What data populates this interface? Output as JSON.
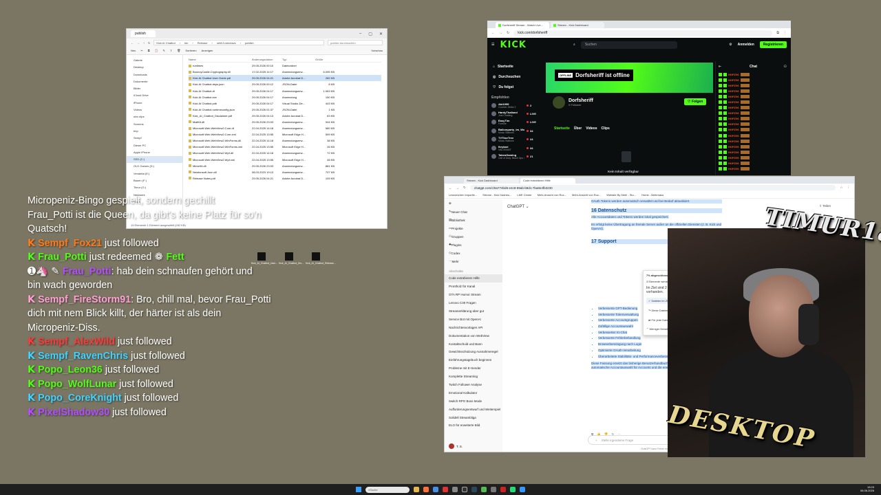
{
  "explorer": {
    "title": "publish",
    "path": [
      "Kick AI Chatbot",
      "bin",
      "Release",
      "net8.0-windows",
      "publish"
    ],
    "search_placeholder": "publish durchsuchen",
    "commands": [
      "Neu",
      "Sortieren",
      "Anzeigen",
      "Vorschau"
    ],
    "nav": [
      "Galerie",
      "Desktop",
      "Downloads",
      "Dokumente",
      "Bilder",
      "iCloud Drive",
      "iPhone",
      "Videos",
      "obs clips",
      "Screens",
      "tmp",
      "Sempf",
      "Dieser PC",
      "Apple iPhone",
      "SSD (C:)",
      "OLD Games (D:)",
      "Vendetta (E:)",
      "Bauen (F:)",
      "Timur (G:)",
      "Netzwerk",
      "Linux"
    ],
    "nav_selected": 14,
    "headers": [
      "Name",
      "Änderungsdatum",
      "Typ",
      "Größe"
    ],
    "files": [
      {
        "name": "runtimes",
        "date": "29.05.2026 00:10",
        "type": "Dateiordner",
        "size": ""
      },
      {
        "name": "BouncyCastle.Cryptography.dll",
        "date": "17.02.2025 14:17",
        "type": "Anwendungserw...",
        "size": "6.095 KB"
      },
      {
        "name": "Kick AI Chatbot User Guide.pdf",
        "date": "29.05.2026 04:21",
        "type": "Adobe Acrobat D...",
        "size": "282 KB"
      },
      {
        "name": "Kick AI Chatbot.deps.json",
        "date": "29.05.2026 00:12",
        "type": "JSON-Datei",
        "size": "8 KB"
      },
      {
        "name": "Kick AI Chatbot.dll",
        "date": "29.05.2026 04:17",
        "type": "Anwendungserw...",
        "size": "1.063 KB"
      },
      {
        "name": "Kick AI Chatbot.exe",
        "date": "29.05.2026 04:17",
        "type": "Anwendung",
        "size": "150 KB"
      },
      {
        "name": "Kick AI Chatbot.pdb",
        "date": "29.05.2026 04:17",
        "type": "Visual Studio-De...",
        "size": "443 KB"
      },
      {
        "name": "Kick AI Chatbot.runtimeconfig.json",
        "date": "29.05.2026 01:37",
        "type": "JSON-Datei",
        "size": "1 KB"
      },
      {
        "name": "Kick_AI_Chatbot_Disclaimer.pdf",
        "date": "29.05.2026 04:13",
        "type": "Adobe Acrobat D...",
        "size": "63 KB"
      },
      {
        "name": "MailKit.dll",
        "date": "29.05.2026 23:03",
        "type": "Anwendungserw...",
        "size": "944 KB"
      },
      {
        "name": "Microsoft.Web.WebView2.Core.dll",
        "date": "22.04.2025 14:18",
        "type": "Anwendungserw...",
        "size": "580 KB"
      },
      {
        "name": "Microsoft.Web.WebView2.Core.xml",
        "date": "22.04.2025 13:55",
        "type": "Microsoft Edge H...",
        "size": "599 KB"
      },
      {
        "name": "Microsoft.Web.WebView2.WinForms.dll",
        "date": "22.04.2025 14:18",
        "type": "Anwendungserw...",
        "size": "38 KB"
      },
      {
        "name": "Microsoft.Web.WebView2.WinForms.xml",
        "date": "22.04.2025 13:55",
        "type": "Microsoft Edge H...",
        "size": "26 KB"
      },
      {
        "name": "Microsoft.Web.WebView2.Wpf.dll",
        "date": "22.04.2025 14:18",
        "type": "Anwendungserw...",
        "size": "72 KB"
      },
      {
        "name": "Microsoft.Web.WebView2.Wpf.xml",
        "date": "22.04.2025 13:55",
        "type": "Microsoft Edge H...",
        "size": "48 KB"
      },
      {
        "name": "MimeKit.dll",
        "date": "29.05.2026 23:03",
        "type": "Anwendungserw...",
        "size": "881 KB"
      },
      {
        "name": "Newtonsoft.Json.dll",
        "date": "08.03.2023 19:13",
        "type": "Anwendungserw...",
        "size": "707 KB"
      },
      {
        "name": "Release Notes.pdf",
        "date": "29.05.2026 04:21",
        "type": "Adobe Acrobat D...",
        "size": "109 KB"
      }
    ],
    "selected_file": 2,
    "status": "19 Elemente   1 Element ausgewählt (282 KB)"
  },
  "kick": {
    "tabs": [
      "Dorfsheriff Stream - Watch Live...",
      "Stream - Kick Dashboard"
    ],
    "url": "kick.com/dorfsheriff",
    "search_placeholder": "Suchen",
    "login": "Anmelden",
    "register": "Registrieren",
    "nav": [
      "Startseite",
      "Durchsuchen",
      "Du folgst"
    ],
    "recommended_label": "Empfohlen",
    "channels": [
      {
        "name": "Abi1995",
        "game": "Counter-Strike 2",
        "viewers": "2"
      },
      {
        "name": "HardyThailand",
        "game": "Just Chatting",
        "viewers": "LIVE"
      },
      {
        "name": "EasyTim",
        "game": "Fortnite",
        "viewers": "LIVE"
      },
      {
        "name": "Balkonparty_im_Wo...",
        "game": "Music Stations",
        "viewers": "34"
      },
      {
        "name": "TVThorTree",
        "game": "Music Stations",
        "viewers": "24"
      },
      {
        "name": "Ihrykari",
        "game": "VALORANT",
        "viewers": "34"
      },
      {
        "name": "TakeoGaming",
        "game": "Call of Duty: Black Ops 7",
        "viewers": "21"
      }
    ],
    "offline_tag": "OFFLINE",
    "offline_text": "Dorfsheriff ist offline",
    "channel_name": "Dorfsheriff",
    "followers": "0 Follower",
    "follow_btn": "Folgen",
    "subtabs": [
      "Startseite",
      "Über",
      "Videos",
      "Clips"
    ],
    "no_content": "Kein Inhalt verfügbar",
    "chat_title": "Chat",
    "chat_name": "HOPZ96"
  },
  "gpt": {
    "tabs": [
      "Stream - Kick Dashboard",
      "Code extrahieren Hilfe"
    ],
    "url": "chatgpt.com/c/6a774bd6-e4c8-89ab-b8d1-7ba8e4fb3230",
    "bookmarks": [
      "Lesezeichen importie...",
      "Stream - Kick Dashbo...",
      "LME Center",
      "Mehl-Ansicht von Ruc...",
      "Mehl-Ansicht von Ruc...",
      "Website By Mehl - Stu...",
      "Home - Beitrmaus"
    ],
    "sidebar_items": [
      "Neuer Chat",
      "Bibliothek",
      "Projekte",
      "Gruppen",
      "Plugins",
      "Codex",
      "Mehr"
    ],
    "history_label": "Abschnitte",
    "history": [
      "Code extrahieren Hilfe",
      "Prontholz für Kanal",
      "GTA RP Humor Stream",
      "Lenovo C30 Fragen",
      "Streamerklärung aber gut",
      "Service Bot mit OpenAI",
      "Nachrichtenvorlagen API",
      "Dokumentation von WebView",
      "Kontaktschuld und Bann",
      "Gewichtsschützung Ausnahmeregel",
      "Einführungstagebuch beginnen",
      "Probleme mit E-Sender",
      "Komplette Streamlog",
      "Twitch Follower Analyse",
      "Emotional Kalkulator",
      "Switch RPG Boss Mode",
      "Aufforderungsentwurf und Weiterspiel",
      "Solidell Streambliga",
      "ELO für erweiterte Bild"
    ],
    "active_history": 0,
    "model": "ChatGPT",
    "share": "Teilen",
    "top_text": "OAuth Tokens werden automatisch verwaltet und bei Bedarf aktualisiert.",
    "h16": "16 Datenschutz",
    "p16a": "Alle Accountdaten und Tokens werden lokal gespeichert.",
    "p16b": "Es erfolgt keine Übertragung an fremde Server außer an die offiziellen Diensten (z. B. Kick und OpenAI).",
    "h17": "17 Support",
    "list": [
      "Verbesserte GPT-Bedienung",
      "Verbesserte Tokenverwaltung",
      "Verbesserte Accountgruppen",
      "Zufällige Accountauswahl",
      "Verbesserter KI-Chat",
      "Verbesserte Fehlerbehandlung",
      "Browserbereinigung nach Login",
      "Optimierte OAuth-Verarbeitung",
      "Überarbeitete Stabilitäts- und Performanceverbesserungen"
    ],
    "summary": "Diese Fassung ersetzt das bisherige Benutzerhandbuch und enthält die neuen Funktionen wie automatische Accountauswahl für Accounts und die erweiterten Automatisierungen.",
    "dialog_title": "7% abgeschlossen",
    "dialog_line": "3 Elemente werden von Desktop nach publish kopiert",
    "dialog_q": "Im Ziel sind 2 Dateien mit dem gleichen Namen vorhanden.",
    "dialog_opts": [
      "Dateien im Ziel ersetzen",
      "Diese Dateien überspringen",
      "Für jede Datei selbst entscheiden"
    ],
    "dialog_more": "Weniger Details",
    "prompt": "Stelle irgendeine Frage",
    "disclaimer": "ChatGPT kann Fehler machen.",
    "user": "T. S."
  },
  "overlay": {
    "lines": [
      {
        "kind": "text",
        "text": "Micropeniz-Bingo gespielt, sondern gechillt"
      },
      {
        "kind": "text",
        "text": "Frau_Potti ist die Queen, da gibt's keine Platz für so'n"
      },
      {
        "kind": "text",
        "text": "Quatsch!"
      },
      {
        "kind": "event",
        "user": "Sempf_Fox21",
        "color": "#ff7a1a",
        "text": "just followed"
      },
      {
        "kind": "event",
        "user": "Frau_Potti",
        "color": "#53fc18",
        "text": "just redeemed",
        "extra": "Fett"
      },
      {
        "kind": "msg",
        "badges": "➊🦄 ✎",
        "user": "Frau_Potti",
        "color": "#b34dff",
        "text": ": hab dein schnaufen gehört und"
      },
      {
        "kind": "text",
        "text": "bin wach geworden"
      },
      {
        "kind": "msg",
        "badges": "",
        "user": "Sempf_FireStorm91",
        "color": "#ff9fd3",
        "text": ": Bro, chill mal, bevor Frau_Potti"
      },
      {
        "kind": "text",
        "text": "dich mit nem Blick killt, der härter ist als dein"
      },
      {
        "kind": "text",
        "text": "Micropeniz-Diss."
      },
      {
        "kind": "event",
        "user": "Sempf_AlexWild",
        "color": "#ff3a3a",
        "text": "just followed"
      },
      {
        "kind": "event",
        "user": "Sempf_RavenChris",
        "color": "#3fd3ff",
        "text": "just followed"
      },
      {
        "kind": "event",
        "user": "Popo_Leon36",
        "color": "#53fc18",
        "text": "just followed"
      },
      {
        "kind": "event",
        "user": "Popo_WolfLunar",
        "color": "#53fc18",
        "text": "just followed"
      },
      {
        "kind": "event",
        "user": "Popo_CoreKnight",
        "color": "#3fd3ff",
        "text": "just followed"
      },
      {
        "kind": "event",
        "user": "PixelShadow30",
        "color": "#b34dff",
        "text": "just followed"
      }
    ]
  },
  "desktop_icons": [
    "Kick_AI_Chatbot_User...",
    "Kick_AI_Chatbot_Dis...",
    "Kick_AI_Chatbot_Release..."
  ],
  "webcam_logos": {
    "top": "TIMUR1804",
    "bottom": "DESKTOP"
  },
  "taskbar": {
    "search": "Suche",
    "time": "19:23",
    "date": "06.06.2026"
  }
}
